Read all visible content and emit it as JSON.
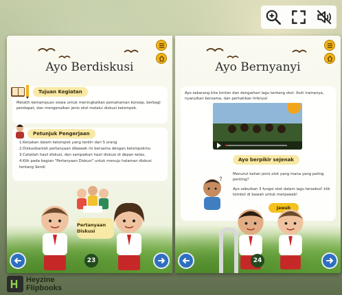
{
  "toolbar": {
    "zoom_icon": "zoom-in-icon",
    "fullscreen_icon": "fullscreen-icon",
    "mute_icon": "mute-icon"
  },
  "left_page": {
    "title": "Ayo Berdiskusi",
    "tujuan_label": "Tujuan Kegiatan",
    "tujuan_text": "Melatih kemampuan siswa untuk meningkatkan pemahaman konsep, berbagi pendapat, dan mengenalkan jenis otot melalui diskusi kelompok.",
    "petunjuk_label": "Petunjuk Pengerjaan",
    "steps": [
      "1.Kerjakan dalam kelompok yang terdiri dari 5 orang",
      "2.Diskusikanlah pertanyaan dibawah ini bersama dengan kelompokmu",
      "3.Catatlah hasil diskusi, dan sampaikan hasil diskusi di depan kelas.",
      "4.Klik pada bagian \"Pertanyaan Diskusi\" untuk menuju halaman diskusi",
      "tentang Sendi"
    ],
    "pertanyaan_button": "Pertanyaan Diskusi",
    "page_number": "23"
  },
  "right_page": {
    "title": "Ayo Bernyanyi",
    "intro": "Ayo sekarang kita tonton dan dengarkan lagu tentang  otot. Ikuti iramanya, nyanyikan bersama, dan perhatikan liriknya!",
    "ayo_label": "Ayo berpikir sejenak",
    "question1": "Menurut kalian jenis otot  yang mana yang paling penting?",
    "question2": "Ayo sebutkan 3 fungsi otot dalam lagu tersebut! klik tombol di bawah untuk menjawab!",
    "jawab_button": "Jawab",
    "page_number": "24"
  },
  "branding": {
    "name_line1": "Heyzine",
    "name_line2": "Flipbooks"
  },
  "colors": {
    "accent_blue": "#2f6fbf",
    "accent_yellow": "#f4c21a",
    "page_number_bg": "#234a1e"
  }
}
